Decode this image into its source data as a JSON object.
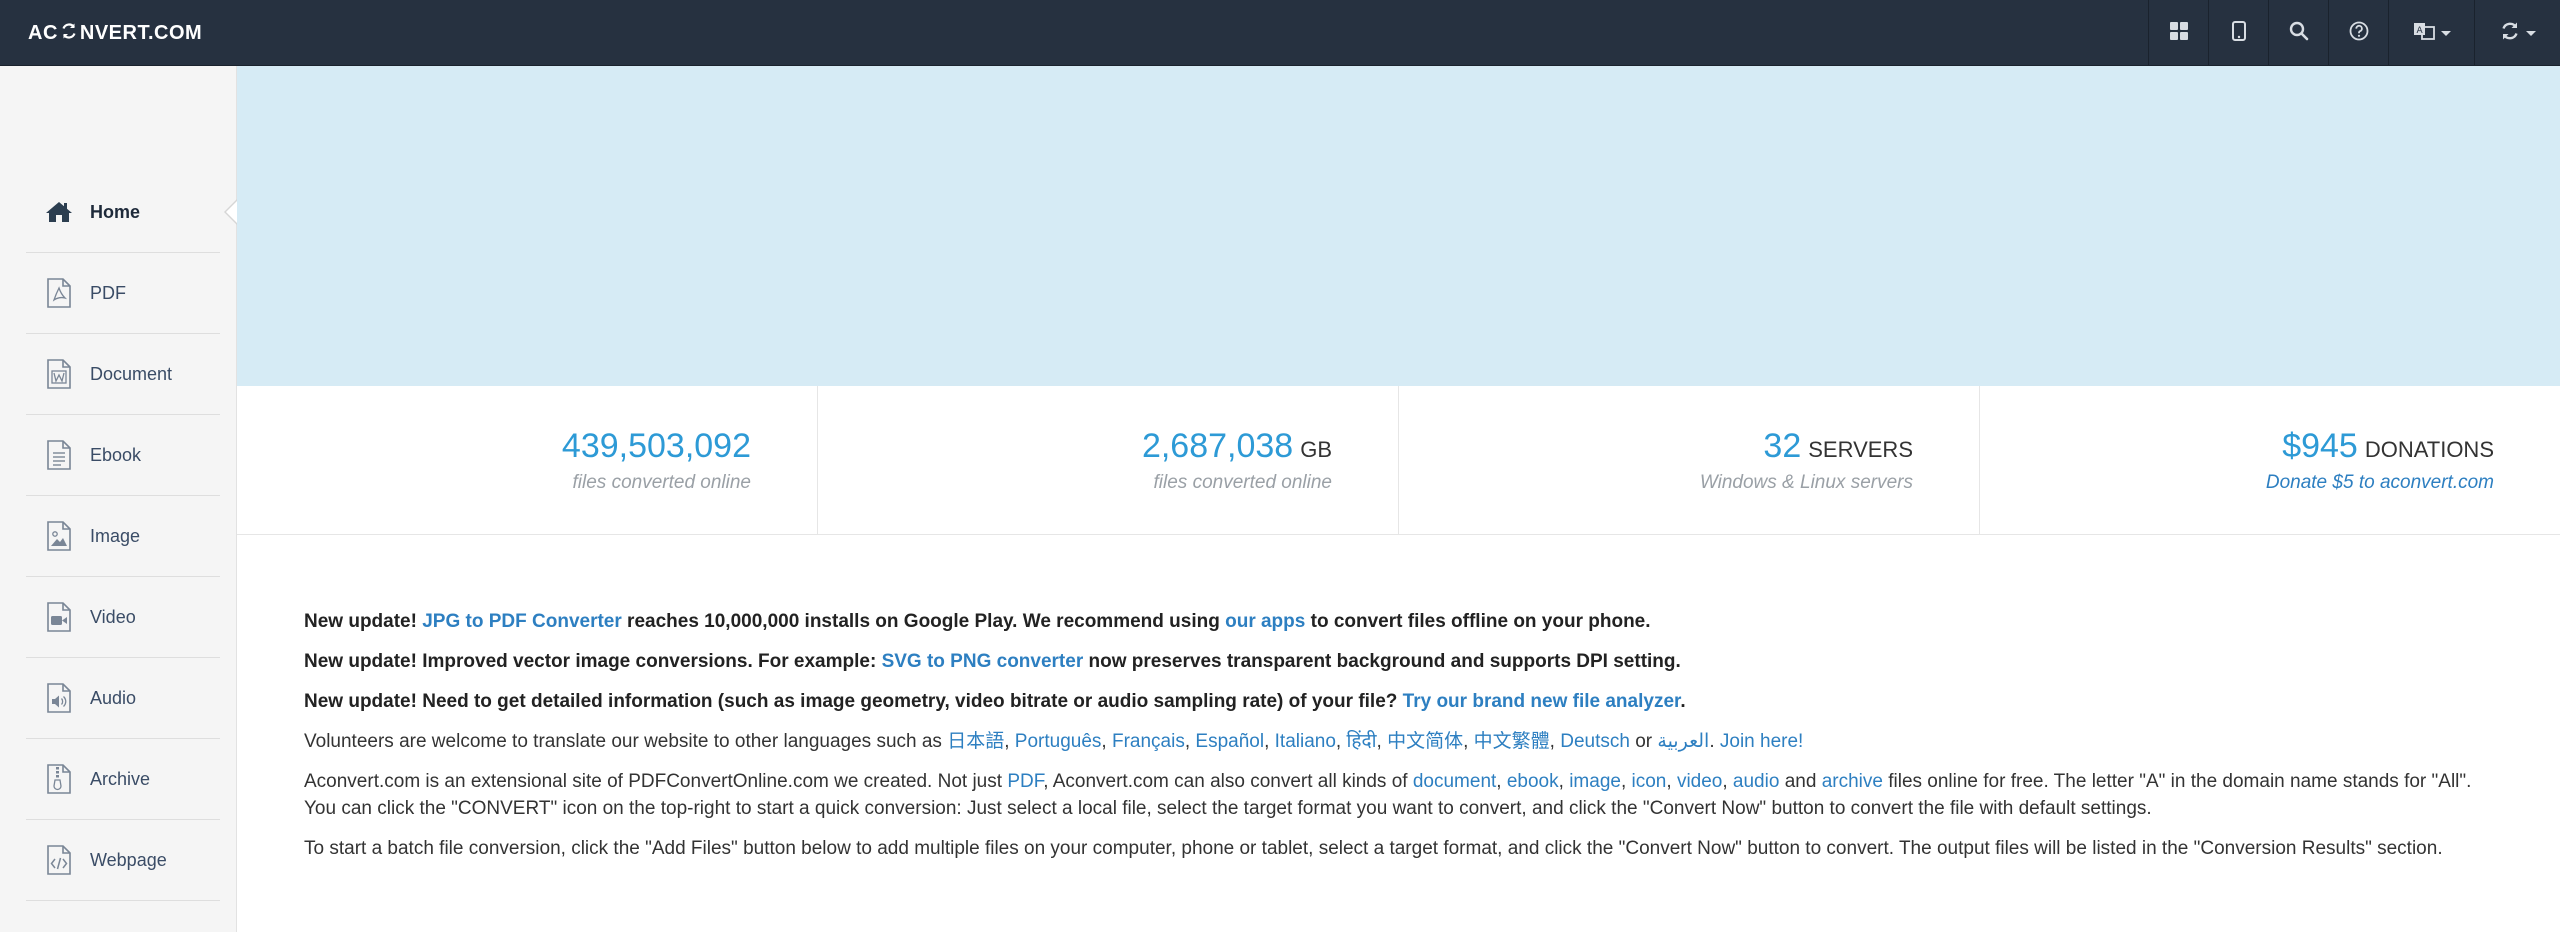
{
  "header": {
    "logo_left": "AC",
    "logo_right": "NVERT.COM",
    "icons": [
      "apps-grid-icon",
      "tablet-icon",
      "search-icon",
      "help-icon",
      "language-icon",
      "convert-icon"
    ]
  },
  "sidebar": {
    "items": [
      {
        "label": "Home",
        "icon": "home-icon",
        "active": true
      },
      {
        "label": "PDF",
        "icon": "pdf-file-icon"
      },
      {
        "label": "Document",
        "icon": "document-file-icon"
      },
      {
        "label": "Ebook",
        "icon": "ebook-file-icon"
      },
      {
        "label": "Image",
        "icon": "image-file-icon"
      },
      {
        "label": "Video",
        "icon": "video-file-icon"
      },
      {
        "label": "Audio",
        "icon": "audio-file-icon"
      },
      {
        "label": "Archive",
        "icon": "archive-file-icon"
      },
      {
        "label": "Webpage",
        "icon": "webpage-file-icon"
      }
    ]
  },
  "stats": [
    {
      "number": "439,503,092",
      "unit": "",
      "caption": "files converted online"
    },
    {
      "number": "2,687,038",
      "unit": "GB",
      "caption": "files converted online"
    },
    {
      "number": "32",
      "unit": "SERVERS",
      "caption": "Windows & Linux servers"
    },
    {
      "number": "$945",
      "unit": "DONATIONS",
      "caption": "Donate $5 to aconvert.com"
    }
  ],
  "content": {
    "update1": {
      "prefix": "New update! ",
      "link1": "JPG to PDF Converter",
      "mid": " reaches 10,000,000 installs on Google Play. We recommend using ",
      "link2": "our apps",
      "suffix": " to convert files offline on your phone."
    },
    "update2": {
      "prefix": "New update! Improved vector image conversions. For example: ",
      "link": "SVG to PNG converter",
      "suffix": " now preserves transparent background and supports DPI setting."
    },
    "update3": {
      "prefix": "New update! Need to get detailed information (such as image geometry, video bitrate or audio sampling rate) of your file? ",
      "link": "Try our brand new file analyzer",
      "suffix": "."
    },
    "volunteers": {
      "prefix": "Volunteers are welcome to translate our website to other languages such as ",
      "languages": [
        "日本語",
        "Português",
        "Français",
        "Español",
        "Italiano",
        "हिंदी",
        "中文简体",
        "中文繁體",
        "Deutsch"
      ],
      "or": " or ",
      "last_language": "العربية",
      "join": "Join here!"
    },
    "about": {
      "prefix": "Aconvert.com is an extensional site of PDFConvertOnline.com we created. Not just ",
      "pdf": "PDF",
      "mid": ", Aconvert.com can also convert all kinds of ",
      "types": [
        "document",
        "ebook",
        "image",
        "icon",
        "video",
        "audio"
      ],
      "and": " and ",
      "archive": "archive",
      "suffix": " files online for free. The letter \"A\" in the domain name stands for \"All\". You can click the \"CONVERT\" icon on the top-right to start a quick conversion: Just select a local file, select the target format you want to convert, and click the \"Convert Now\" button to convert the file with default settings."
    },
    "batch": "To start a batch file conversion, click the \"Add Files\" button below to add multiple files on your computer, phone or tablet, select a target format, and click the \"Convert Now\" button to convert. The output files will be listed in the \"Conversion Results\" section."
  },
  "colors": {
    "navbar": "#263140",
    "accent": "#2d9ad6",
    "link": "#2d7fc1",
    "banner": "#d6ebf5"
  }
}
